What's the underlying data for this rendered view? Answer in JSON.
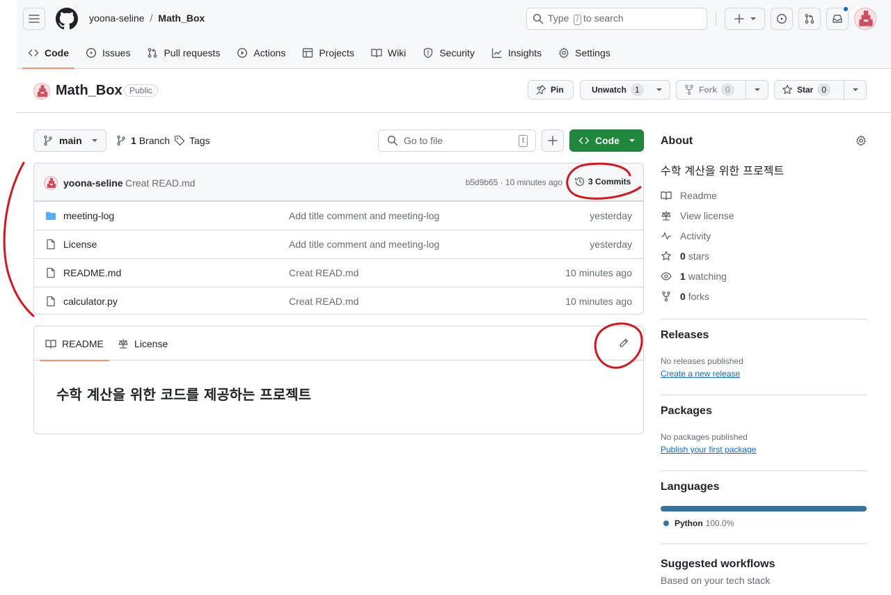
{
  "header": {
    "owner": "yoona-seline",
    "separator": "/",
    "repo": "Math_Box",
    "search_prefix": "Type",
    "search_key": "/",
    "search_suffix": "to search",
    "notification_color": "#0969da"
  },
  "repo_nav": [
    {
      "label": "Code",
      "icon": "code-icon",
      "active": true
    },
    {
      "label": "Issues",
      "icon": "issue-icon"
    },
    {
      "label": "Pull requests",
      "icon": "pull-request-icon"
    },
    {
      "label": "Actions",
      "icon": "play-icon"
    },
    {
      "label": "Projects",
      "icon": "table-icon"
    },
    {
      "label": "Wiki",
      "icon": "book-icon"
    },
    {
      "label": "Security",
      "icon": "shield-icon"
    },
    {
      "label": "Insights",
      "icon": "graph-icon"
    },
    {
      "label": "Settings",
      "icon": "gear-icon"
    }
  ],
  "repo_title": {
    "name": "Math_Box",
    "visibility": "Public",
    "pin_label": "Pin",
    "unwatch_label": "Unwatch",
    "watch_count": "1",
    "fork_label": "Fork",
    "fork_count": "0",
    "star_label": "Star",
    "star_count": "0"
  },
  "file_nav": {
    "branch": "main",
    "branch_count": "1",
    "branch_word": "Branch",
    "tags_label": "Tags",
    "goto_placeholder": "Go to file",
    "goto_key": "t",
    "code_label": "Code",
    "code_color": "#1f883d"
  },
  "latest_commit": {
    "author": "yoona-seline",
    "message": "Creat READ.md",
    "meta": "b5d9b65 · 10 minutes ago",
    "commits_label": "3 Commits"
  },
  "files": [
    {
      "type": "folder",
      "icon": "folder-icon",
      "name": "meeting-log",
      "commit": "Add title comment and meeting-log",
      "age": "yesterday"
    },
    {
      "type": "file",
      "icon": "file-icon",
      "name": "License",
      "commit": "Add title comment and meeting-log",
      "age": "yesterday"
    },
    {
      "type": "file",
      "icon": "file-icon",
      "name": "README.md",
      "commit": "Creat READ.md",
      "age": "10 minutes ago"
    },
    {
      "type": "file",
      "icon": "file-icon",
      "name": "calculator.py",
      "commit": "Creat READ.md",
      "age": "10 minutes ago"
    }
  ],
  "readme": {
    "tab_readme": "README",
    "tab_license": "License",
    "content": "수학 계산을 위한 코드를 제공하는 프로젝트"
  },
  "sidebar": {
    "about_title": "About",
    "description": "수학 계산을 위한 프로젝트",
    "links": [
      {
        "icon": "book-icon",
        "label": "Readme"
      },
      {
        "icon": "law-icon",
        "label": "View license"
      },
      {
        "icon": "pulse-icon",
        "label": "Activity"
      },
      {
        "icon": "star-icon",
        "bold": "0",
        "label": "stars"
      },
      {
        "icon": "eye-icon",
        "bold": "1",
        "label": "watching"
      },
      {
        "icon": "fork-icon",
        "bold": "0",
        "label": "forks"
      }
    ],
    "releases_title": "Releases",
    "releases_none": "No releases published",
    "releases_link": "Create a new release",
    "packages_title": "Packages",
    "packages_none": "No packages published",
    "packages_link": "Publish your first package",
    "languages_title": "Languages",
    "language_name": "Python",
    "language_pct": "100.0%",
    "language_color": "#3572a5",
    "workflows_title": "Suggested workflows",
    "workflows_sub": "Based on your tech stack"
  },
  "colors": {
    "accent_underline": "#fd8c73",
    "annotation_red": "#d9141b"
  }
}
